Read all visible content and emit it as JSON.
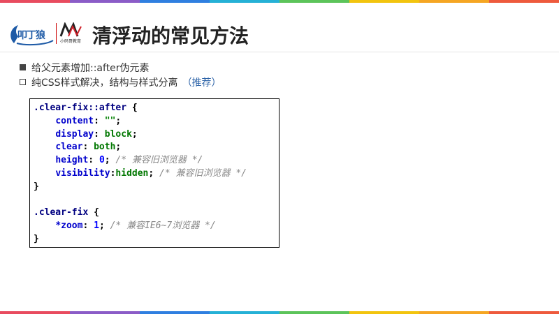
{
  "header": {
    "title": "清浮动的常见方法",
    "logo_left_text": "叩丁狼",
    "logo_right_caption": "小码哥教育"
  },
  "colors": {
    "stripe": [
      "#e84b5f",
      "#8b5cc7",
      "#2f7fe0",
      "#25b1d6",
      "#5cc45a",
      "#f2c40f",
      "#f5a623",
      "#ee5a3d"
    ],
    "title": "#222222",
    "recommend": "#2e64a8"
  },
  "bullets": [
    {
      "marker": "filled-square",
      "text": "给父元素增加::after伪元素"
    },
    {
      "marker": "hollow-square",
      "text": "纯CSS样式解决，结构与样式分离",
      "note": "（推荐）"
    }
  ],
  "code": {
    "selector1": ".clear-fix::after",
    "content_prop": "content",
    "content_val": "\"\"",
    "display_prop": "display",
    "display_val": "block",
    "clear_prop": "clear",
    "clear_val": "both",
    "height_prop": "height",
    "height_val": "0",
    "height_comment": "/* 兼容旧浏览器 */",
    "visibility_prop": "visibility",
    "visibility_val": "hidden",
    "visibility_comment": "/* 兼容旧浏览器 */",
    "selector2": ".clear-fix",
    "zoom_prop": "*zoom",
    "zoom_val": "1",
    "zoom_comment": "/* 兼容IE6~7浏览器 */"
  }
}
